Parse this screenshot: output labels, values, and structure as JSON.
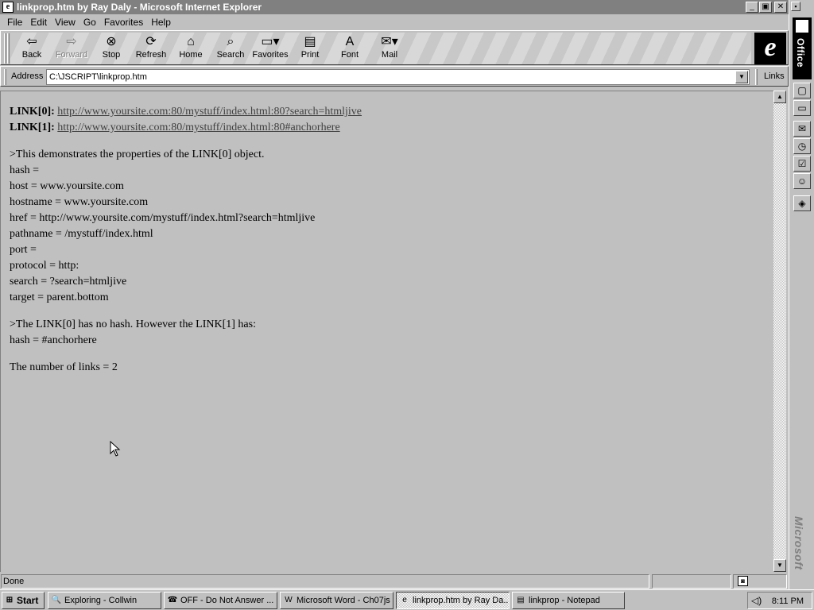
{
  "window": {
    "title": "linkprop.htm by Ray Daly - Microsoft Internet Explorer",
    "minimize": "_",
    "restore": "▣",
    "close": "✕"
  },
  "menu": [
    "File",
    "Edit",
    "View",
    "Go",
    "Favorites",
    "Help"
  ],
  "toolbar": {
    "buttons": [
      {
        "label": "Back",
        "icon": "back-arrow-icon",
        "glyph": "⇦",
        "enabled": true
      },
      {
        "label": "Forward",
        "icon": "forward-arrow-icon",
        "glyph": "⇨",
        "enabled": false
      },
      {
        "label": "Stop",
        "icon": "stop-icon",
        "glyph": "⊗",
        "enabled": true
      },
      {
        "label": "Refresh",
        "icon": "refresh-icon",
        "glyph": "⟳",
        "enabled": true
      },
      {
        "label": "Home",
        "icon": "home-icon",
        "glyph": "⌂",
        "enabled": true
      },
      {
        "label": "Search",
        "icon": "search-icon",
        "glyph": "⌕",
        "enabled": true
      },
      {
        "label": "Favorites",
        "icon": "favorites-folder-icon",
        "glyph": "▭▾",
        "enabled": true
      },
      {
        "label": "Print",
        "icon": "printer-icon",
        "glyph": "▤",
        "enabled": true
      },
      {
        "label": "Font",
        "icon": "font-icon",
        "glyph": "A",
        "enabled": true
      },
      {
        "label": "Mail",
        "icon": "mail-icon",
        "glyph": "✉▾",
        "enabled": true
      }
    ],
    "logo": "e"
  },
  "address": {
    "label": "Address",
    "value": "C:\\JSCRIPT\\linkprop.htm",
    "links_label": "Links"
  },
  "content": {
    "link0_label": "LINK[0]:",
    "link0_url": "http://www.yoursite.com:80/mystuff/index.html:80?search=htmljive",
    "link1_label": "LINK[1]:",
    "link1_url": "http://www.yoursite.com:80/mystuff/index.html:80#anchorhere",
    "properties": [
      ">This demonstrates the properties of the LINK[0] object.",
      "hash =",
      "host = www.yoursite.com",
      "hostname = www.yoursite.com",
      "href = http://www.yoursite.com/mystuff/index.html?search=htmljive",
      "pathname = /mystuff/index.html",
      "port =",
      "protocol = http:",
      "search = ?search=htmljive",
      "target = parent.bottom"
    ],
    "hash_note": [
      ">The LINK[0] has no hash. However the LINK[1] has:",
      "hash = #anchorhere"
    ],
    "link_count": "The number of links = 2"
  },
  "status": {
    "text": "Done"
  },
  "office_bar": {
    "title": "Office",
    "vendor": "Microsoft"
  },
  "taskbar": {
    "start": "Start",
    "tasks": [
      {
        "label": "Exploring - Collwin",
        "icon": "explorer-icon",
        "glyph": "🔍",
        "active": false
      },
      {
        "label": "OFF - Do Not Answer ...",
        "icon": "phone-icon",
        "glyph": "☎",
        "active": false
      },
      {
        "label": "Microsoft Word - Ch07js",
        "icon": "word-icon",
        "glyph": "W",
        "active": false
      },
      {
        "label": "linkprop.htm by Ray Da...",
        "icon": "ie-icon",
        "glyph": "e",
        "active": true
      },
      {
        "label": "linkprop - Notepad",
        "icon": "notepad-icon",
        "glyph": "▤",
        "active": false
      }
    ],
    "clock": "8:11 PM"
  }
}
